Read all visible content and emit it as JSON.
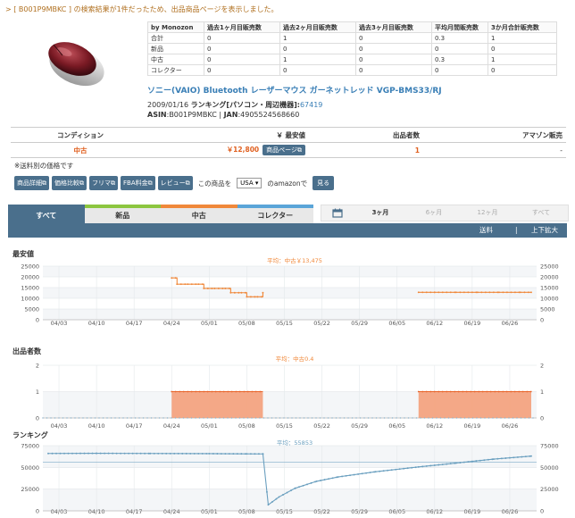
{
  "header": {
    "prefix": "> [ ",
    "asin_link": "B001P9MBKC",
    "message": " ] の検索結果が1件だったため、出品商品ページを表示しました。"
  },
  "stats_table": {
    "headers": [
      "by Monozon",
      "過去1ヶ月目販売数",
      "過去2ヶ月目販売数",
      "過去3ヶ月目販売数",
      "平均月間販売数",
      "3か月合計販売数"
    ],
    "rows": [
      [
        "合計",
        "0",
        "1",
        "0",
        "0.3",
        "1"
      ],
      [
        "新品",
        "0",
        "0",
        "0",
        "0",
        "0"
      ],
      [
        "中古",
        "0",
        "1",
        "0",
        "0.3",
        "1"
      ],
      [
        "コレクター",
        "0",
        "0",
        "0",
        "0",
        "0"
      ]
    ]
  },
  "product": {
    "title": "ソニー(VAIO) Bluetooth レーザーマウス ガーネットレッド VGP-BMS33/RJ",
    "date": "2009/01/16 ",
    "rank_label": "ランキング[パソコン・周辺機器]:",
    "rank_value": "67419",
    "asin_label": "ASIN",
    "asin_value": ":B001P9MBKC | ",
    "jan_label": "JAN",
    "jan_value": ":4905524568660"
  },
  "price_table": {
    "headers": [
      "コンディション",
      "￥ 最安値",
      "出品者数",
      "アマゾン販売"
    ],
    "condition": "中古",
    "price": "￥12,800",
    "product_page_button": "商品ページ⧉",
    "sellers": "1",
    "amazon": "-"
  },
  "note": "※送料別の価格です",
  "buttons": {
    "detail": "商品詳細⧉",
    "compare": "価格比較⧉",
    "flea": "フリマ⧉",
    "fba": "FBA料金⧉",
    "review": "レビュー⧉",
    "country_prefix": "この商品を",
    "country_value": "USA ▾",
    "country_suffix": "のamazonで",
    "view": "見る"
  },
  "tabs": [
    "すべて",
    "新品",
    "中古",
    "コレクター"
  ],
  "ranges": [
    "3ヶ月",
    "6ヶ月",
    "12ヶ月",
    "すべて"
  ],
  "toolbar": {
    "shipping": "送料",
    "zoom": "上下拡大"
  },
  "colors": {
    "accent": "#4a6f8c",
    "used": "#f0883a",
    "rank": "#6a9fbf",
    "new": "#8cc63f",
    "collector": "#5aa5d8"
  },
  "x_ticks": [
    "04/03",
    "04/10",
    "04/17",
    "04/24",
    "05/01",
    "05/08",
    "05/15",
    "05/22",
    "05/29",
    "06/05",
    "06/12",
    "06/19",
    "06/26"
  ],
  "chart_data": [
    {
      "type": "line",
      "title": "最安値",
      "subtitle": "平均：中古￥13,475",
      "ylim": [
        0,
        25000
      ],
      "yticks": [
        0,
        5000,
        10000,
        15000,
        20000,
        25000
      ],
      "grid": true,
      "series": [
        {
          "name": "中古",
          "color": "#f0883a",
          "points": [
            [
              "04/24",
              19500
            ],
            [
              "04/25",
              16600
            ],
            [
              "04/27",
              16600
            ],
            [
              "04/29",
              16600
            ],
            [
              "04/30",
              14600
            ],
            [
              "05/02",
              14600
            ],
            [
              "05/04",
              14600
            ],
            [
              "05/05",
              12600
            ],
            [
              "05/07",
              12600
            ],
            [
              "05/08",
              10700
            ],
            [
              "05/10",
              10700
            ],
            [
              "05/11",
              12600
            ],
            null,
            [
              "06/09",
              12800
            ],
            [
              "06/12",
              12800
            ],
            [
              "06/16",
              12800
            ],
            [
              "06/20",
              12800
            ],
            [
              "06/24",
              12800
            ],
            [
              "06/28",
              12800
            ],
            [
              "06/30",
              12800
            ]
          ]
        }
      ]
    },
    {
      "type": "area",
      "title": "出品者数",
      "subtitle": "平均：中古0.4",
      "ylim": [
        0,
        2
      ],
      "yticks": [
        0,
        1,
        2
      ],
      "grid": true,
      "series": [
        {
          "name": "中古",
          "color": "#f0883a",
          "segments": [
            [
              "04/24",
              "05/11",
              1
            ],
            [
              "06/09",
              "06/30",
              1
            ]
          ]
        }
      ]
    },
    {
      "type": "line",
      "title": "ランキング",
      "subtitle": "平均：55853",
      "ylim": [
        0,
        75000
      ],
      "yticks": [
        0,
        25000,
        50000,
        75000
      ],
      "average": 55853,
      "grid": true,
      "series": [
        {
          "name": "ランキング",
          "color": "#6a9fbf",
          "points": [
            [
              "04/01",
              66000
            ],
            [
              "04/10",
              66200
            ],
            [
              "04/20",
              66000
            ],
            [
              "05/01",
              65800
            ],
            [
              "05/08",
              65600
            ],
            [
              "05/11",
              65500
            ],
            [
              "05/12",
              7000
            ],
            [
              "05/14",
              16000
            ],
            [
              "05/17",
              26000
            ],
            [
              "05/21",
              34000
            ],
            [
              "05/25",
              39000
            ],
            [
              "06/01",
              45000
            ],
            [
              "06/09",
              50500
            ],
            [
              "06/16",
              55000
            ],
            [
              "06/23",
              59500
            ],
            [
              "06/30",
              63000
            ]
          ]
        }
      ]
    }
  ]
}
